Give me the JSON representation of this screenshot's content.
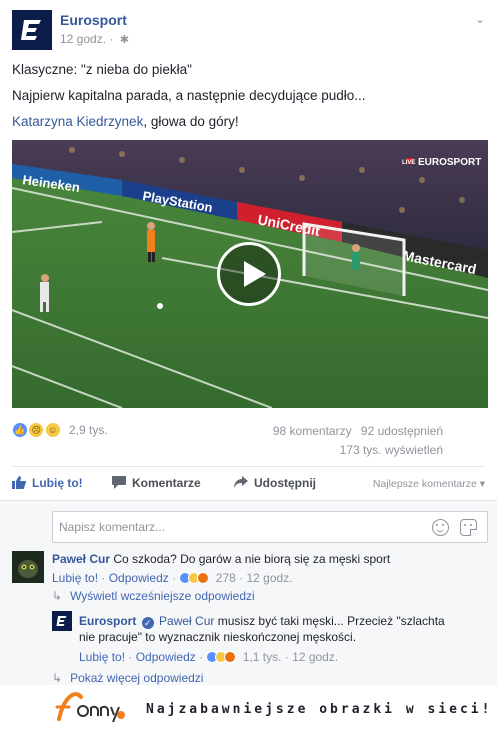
{
  "post": {
    "page_name": "Eurosport",
    "time": "12 godz.",
    "privacy_icon": "gear-icon",
    "lines": [
      "Klasyczne: \"z nieba do piekła\"",
      "Najpierw kapitalna parada, a następnie decydujące pudło..."
    ],
    "mention": "Katarzyna Kiedrzynek",
    "mention_suffix": ", głowa do góry!",
    "video": {
      "banners": [
        "Heineken",
        "PlayStation",
        "UniCredit",
        "Mastercard"
      ],
      "overlay_badge": "LIVE",
      "overlay_logo": "EUROSPORT"
    }
  },
  "stats": {
    "reactions_count": "2,9 tys.",
    "comments": "98 komentarzy",
    "shares": "92 udostępnień",
    "views": "173 tys. wyświetleń"
  },
  "actions": {
    "like": "Lubię to!",
    "comment": "Komentarze",
    "share": "Udostępnij",
    "sort": "Najlepsze komentarze"
  },
  "comment_box": {
    "placeholder": "Napisz komentarz..."
  },
  "comments": [
    {
      "author": "Paweł Cur",
      "text": "Co szkoda? Do garów a nie biorą się za męski sport",
      "like": "Lubię to!",
      "reply": "Odpowiedz",
      "reactions": "278",
      "time": "12 godz.",
      "earlier_replies": "Wyświetl wcześniejsze odpowiedzi"
    },
    {
      "author": "Eurosport",
      "mention": "Paweł Cur",
      "text_line1": "musisz być taki męski... Przecież \"szlachta",
      "text_line2": "nie pracuje\" to wyznacznik nieskończonej męskości.",
      "like": "Lubię to!",
      "reply": "Odpowiedz",
      "reactions": "1,1 tys.",
      "time": "12 godz.",
      "more_replies": "Pokaż więcej odpowiedzi"
    }
  ],
  "footer": {
    "tagline": "Najzabawniejsze obrazki w sieci!"
  }
}
